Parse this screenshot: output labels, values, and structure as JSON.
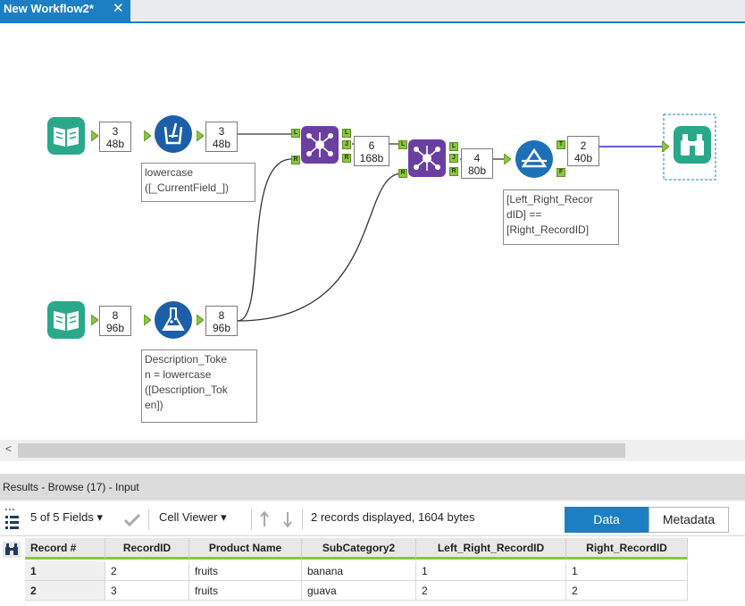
{
  "tab": {
    "title": "New Workflow2*",
    "close": "✕"
  },
  "counts": [
    {
      "n": "3",
      "b": "48b"
    },
    {
      "n": "3",
      "b": "48b"
    },
    {
      "n": "6",
      "b": "168b"
    },
    {
      "n": "4",
      "b": "80b"
    },
    {
      "n": "2",
      "b": "40b"
    },
    {
      "n": "8",
      "b": "96b"
    },
    {
      "n": "8",
      "b": "96b"
    }
  ],
  "annotations": {
    "formula1": "lowercase\n([_CurrentField_])",
    "formula2": "Description_Toke\nn = lowercase\n([Description_Tok\nen])",
    "filter": "[Left_Right_Recor\ndID] ==\n[Right_RecordID]"
  },
  "anchors": {
    "left": "L",
    "join": "J",
    "right": "R",
    "true": "T",
    "false": "F"
  },
  "scroll": {
    "left_arrow": "<"
  },
  "results": {
    "title": "Results - Browse (17) - Input",
    "fields_label": "5 of 5 Fields",
    "cell_viewer": "Cell Viewer",
    "status": "2 records displayed, 1604 bytes",
    "data_btn": "Data",
    "metadata_btn": "Metadata"
  },
  "table": {
    "columns": [
      "Record #",
      "RecordID",
      "Product Name",
      "SubCategory2",
      "Left_Right_RecordID",
      "Right_RecordID"
    ],
    "rows": [
      [
        "1",
        "2",
        "fruits",
        "banana",
        "1",
        "1"
      ],
      [
        "2",
        "3",
        "fruits",
        "guava",
        "2",
        "2"
      ]
    ]
  },
  "colors": {
    "accent": "#1c7fc4",
    "input_tool": "#2aa88a",
    "formula_tool": "#1c5fa8",
    "join_tool": "#6b3fa0",
    "filter_tool": "#1c6fb8",
    "browse_tool": "#2aa88a",
    "anchor": "#8bc63e"
  },
  "icons": [
    "book-icon",
    "formula-icon",
    "flask-icon",
    "join-icon",
    "filter-icon",
    "binoculars-icon",
    "fields-list-icon",
    "checkmark-icon",
    "arrow-up-icon",
    "arrow-down-icon"
  ]
}
